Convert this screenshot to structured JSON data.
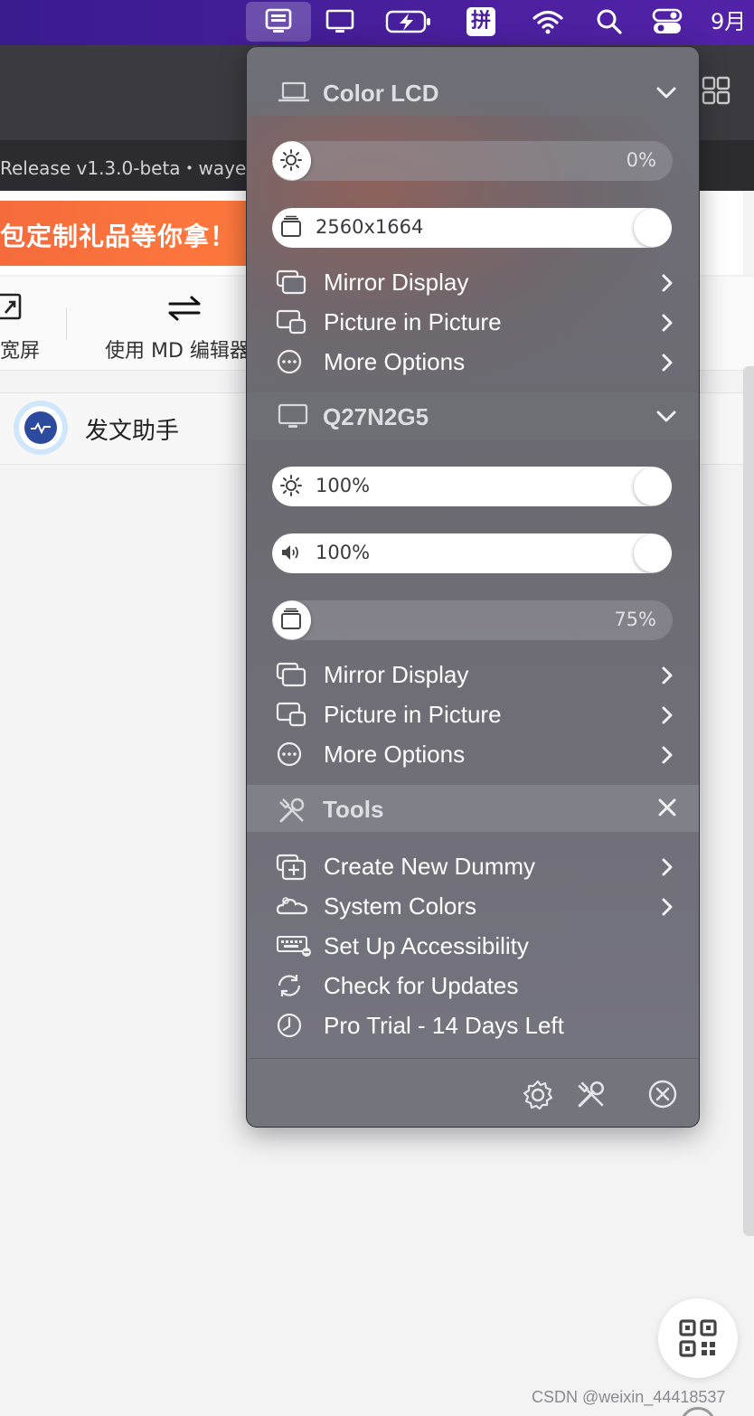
{
  "menubar": {
    "icons": [
      "display-manager-icon",
      "monitor-icon",
      "battery-charging-icon",
      "input-method-pinyin-icon",
      "wifi-icon",
      "search-icon",
      "control-center-icon"
    ],
    "input_method_label": "拼",
    "date_partial": "9月"
  },
  "background": {
    "address_text": "Release v1.3.0-beta・waye",
    "banner_text": "包定制礼品等你拿！",
    "tools": {
      "wide_label": "宽屏",
      "md_label": "使用 MD 编辑器"
    },
    "assistant_label": "发文助手",
    "watermark": "CSDN @weixin_44418537"
  },
  "menu": {
    "display1": {
      "title": "Color LCD",
      "brightness_value": "0%",
      "brightness_level": 0.0,
      "resolution_value": "2560x1664",
      "resolution_level": 1.0,
      "items": [
        {
          "label": "Mirror Display",
          "icon": "mirror-display-icon"
        },
        {
          "label": "Picture in Picture",
          "icon": "picture-in-picture-icon"
        },
        {
          "label": "More Options",
          "icon": "more-options-icon"
        }
      ]
    },
    "display2": {
      "title": "Q27N2G5",
      "brightness_value": "100%",
      "brightness_level": 1.0,
      "volume_value": "100%",
      "volume_level": 1.0,
      "layer_value": "75%",
      "layer_level": 0.0,
      "items": [
        {
          "label": "Mirror Display",
          "icon": "mirror-display-icon"
        },
        {
          "label": "Picture in Picture",
          "icon": "picture-in-picture-icon"
        },
        {
          "label": "More Options",
          "icon": "more-options-icon"
        }
      ]
    },
    "tools": {
      "title": "Tools",
      "items": [
        {
          "label": "Create New Dummy",
          "icon": "create-dummy-icon",
          "has_submenu": true
        },
        {
          "label": "System Colors",
          "icon": "system-colors-icon",
          "has_submenu": true
        },
        {
          "label": "Set Up Accessibility",
          "icon": "keyboard-icon",
          "has_submenu": false
        },
        {
          "label": "Check for Updates",
          "icon": "refresh-icon",
          "has_submenu": false
        },
        {
          "label": "Pro Trial - 14 Days Left",
          "icon": "clock-icon",
          "has_submenu": false
        }
      ]
    },
    "footer_icons": [
      "settings-gear-icon",
      "tools-icon",
      "quit-icon"
    ]
  },
  "colors": {
    "menubar": "#4a1f9e",
    "menu_bg": "#6f6f78",
    "banner": "#f56b3c"
  }
}
